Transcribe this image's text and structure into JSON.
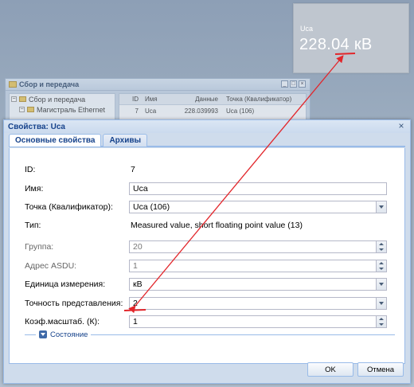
{
  "widget": {
    "name": "Uca",
    "value": "228.04 кВ"
  },
  "background_window": {
    "title": "Сбор и передача",
    "tree": [
      {
        "label": "Сбор и передача"
      },
      {
        "label": "Магистраль Ethernet"
      }
    ],
    "grid": {
      "headers": [
        "ID",
        "Имя",
        "Данные",
        "Точка (Квалификатор)"
      ],
      "rows": [
        [
          "7",
          "Uca",
          "228.039993",
          "Uca (106)"
        ]
      ]
    },
    "buttons": [
      "_",
      "□",
      "×"
    ]
  },
  "dialog": {
    "title": "Свойства: Uca",
    "close": "×",
    "tabs": [
      "Основные свойства",
      "Архивы"
    ],
    "fields": {
      "id": {
        "label": "ID:",
        "value": "7"
      },
      "name": {
        "label": "Имя:",
        "value": "Uca"
      },
      "point": {
        "label": "Точка (Квалификатор):",
        "value": "Uca (106)"
      },
      "type": {
        "label": "Тип:",
        "value": "Measured value, short floating point value (13)"
      },
      "group": {
        "label": "Группа:",
        "value": "20"
      },
      "asdu": {
        "label": "Адрес ASDU:",
        "value": "1"
      },
      "unit": {
        "label": "Единица измерения:",
        "value": "кВ"
      },
      "precision": {
        "label": "Точность представления:",
        "value": "2"
      },
      "scale": {
        "label": "Коэф.масштаб. (К):",
        "value": "1"
      }
    },
    "state_section": "Состояние",
    "ok": "OK",
    "cancel": "Отмена"
  },
  "annotation": {
    "arrow_color": "#e2262b"
  }
}
